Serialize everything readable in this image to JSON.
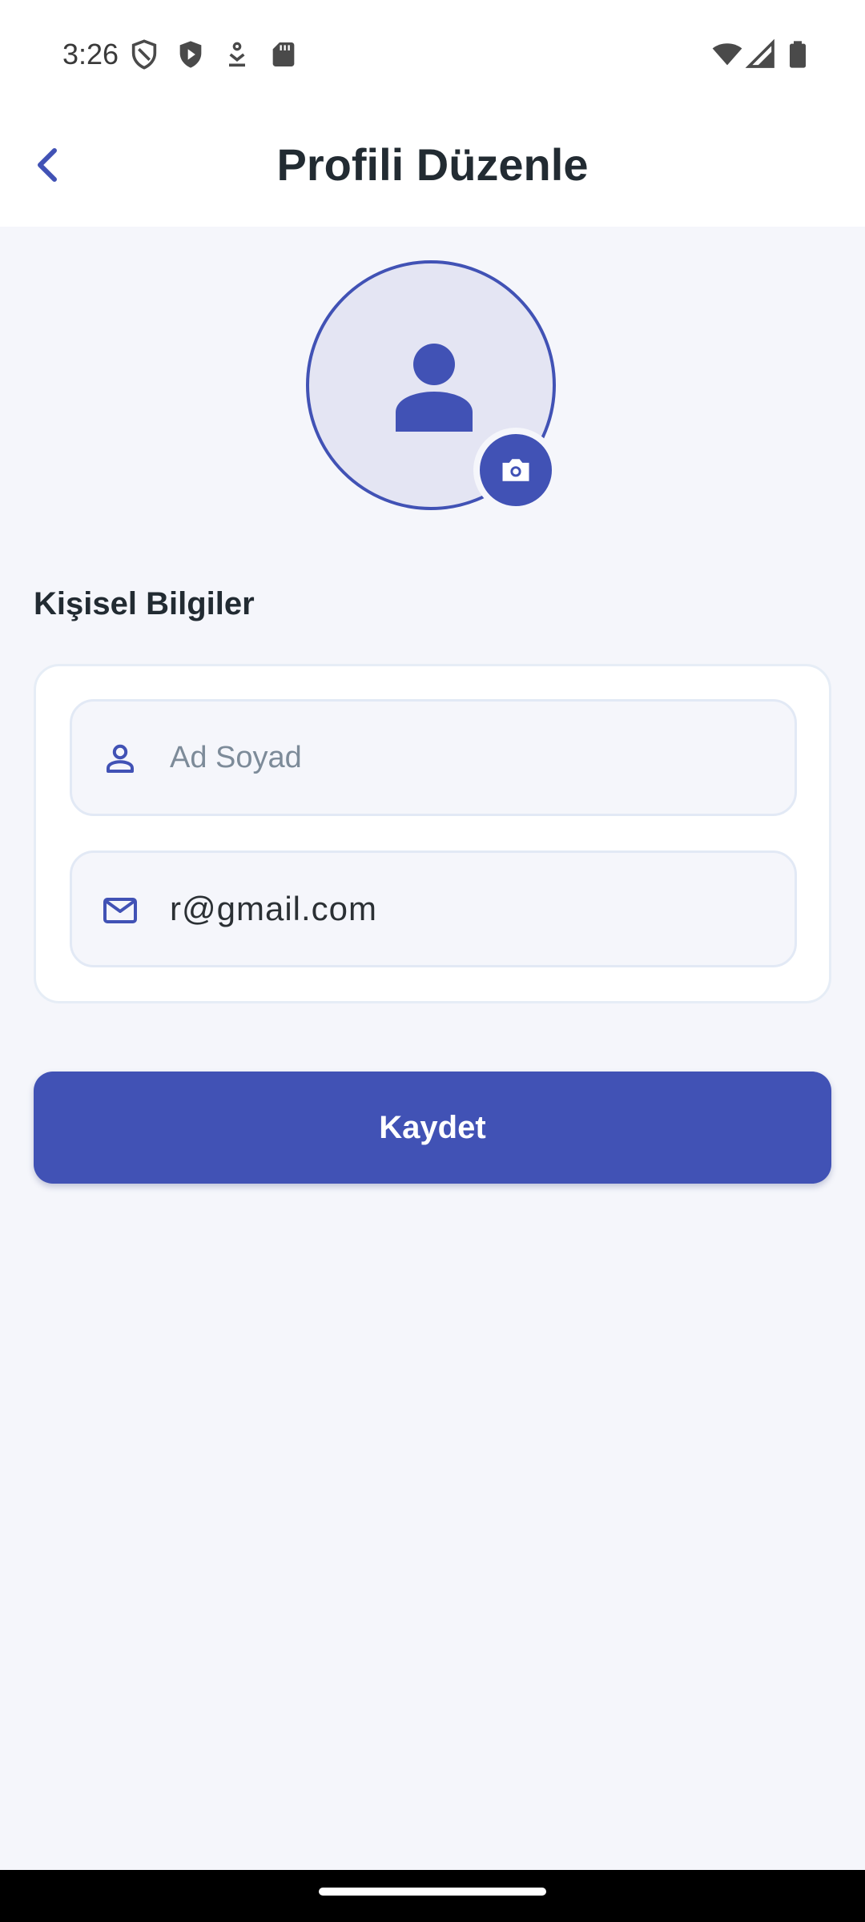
{
  "status_bar": {
    "time": "3:26",
    "left_icons": [
      "shield-outline-icon",
      "shield-play-icon",
      "download-icon",
      "sd-card-icon"
    ],
    "right_icons": [
      "wifi-icon",
      "signal-icon",
      "battery-icon"
    ]
  },
  "app_bar": {
    "title": "Profili Düzenle",
    "back_icon": "chevron-left-icon"
  },
  "avatar": {
    "icon": "person-icon",
    "edit_icon": "camera-icon"
  },
  "section": {
    "title": "Kişisel Bilgiler"
  },
  "form": {
    "name": {
      "icon": "person-outline-icon",
      "value": "",
      "placeholder": "Ad Soyad"
    },
    "email": {
      "icon": "mail-icon",
      "value": "r@gmail.com",
      "placeholder": ""
    }
  },
  "actions": {
    "save_label": "Kaydet"
  },
  "colors": {
    "primary": "#4152b5",
    "background": "#f5f6fb",
    "title_text": "#222b32",
    "placeholder_text": "#7d8b99"
  }
}
